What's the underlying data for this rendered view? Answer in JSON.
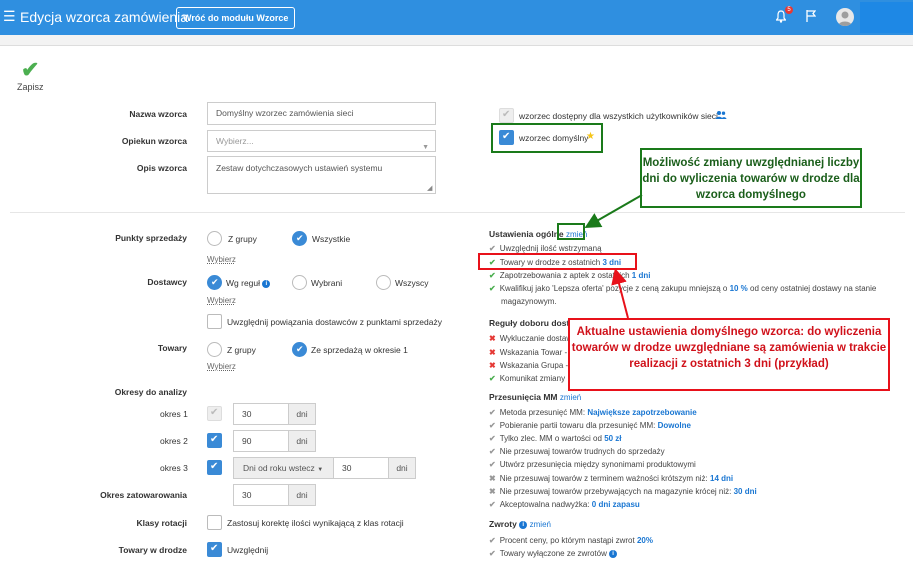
{
  "topbar": {
    "title": "Edycja wzorca zamówienia",
    "back_button": "Wróć do modułu Wzorce",
    "notification_count": "5",
    "colors": {
      "bar": "#2f8fe0"
    }
  },
  "toolbar": {
    "save_label": "Zapisz"
  },
  "form": {
    "name_label": "Nazwa wzorca",
    "name_value": "Domyślny wzorzec zamówienia sieci",
    "guardian_label": "Opiekun wzorca",
    "guardian_placeholder": "Wybierz...",
    "desc_label": "Opis wzorca",
    "desc_value": "Zestaw dotychczasowych ustawień systemu",
    "available_all": "wzorzec dostępny dla wszystkich użytkowników sieci",
    "default_template": "wzorzec domyślny"
  },
  "left": {
    "points_label": "Punkty sprzedaży",
    "points_opt1": "Z grupy",
    "points_opt2": "Wszystkie",
    "choose": "Wybierz",
    "suppliers_label": "Dostawcy",
    "sup_opt1": "Wg reguł",
    "sup_opt2": "Wybrani",
    "sup_opt3": "Wszyscy",
    "sup_links": "Uwzględnij powiązania dostawców z punktami sprzedaży",
    "goods_label": "Towary",
    "goods_opt1": "Z grupy",
    "goods_opt2": "Ze sprzedażą w okresie 1",
    "periods_label": "Okresy do analizy",
    "period1_label": "okres 1",
    "period1_value": "30",
    "period2_label": "okres 2",
    "period2_value": "90",
    "period3_label": "okres 3",
    "period3_select": "Dni od roku wstecz",
    "period3_value": "30",
    "days_unit": "dni",
    "stock_label": "Okres zatowarowania",
    "stock_value": "30",
    "rotation_label": "Klasy rotacji",
    "rotation_text": "Zastosuj korektę ilości wynikającą z klas rotacji",
    "transit_label": "Towary w drodze",
    "transit_text": "Uwzględnij"
  },
  "right": {
    "general_head": "Ustawienia ogólne",
    "change": "zmień",
    "g1": "Uwzględnij ilość wstrzymaną",
    "g2_prefix": "Towary w drodze z ostatnich",
    "g2_value": "3 dni",
    "g3_prefix": "Zapotrzebowania z aptek z ostatnich",
    "g3_value": "1 dni",
    "g4_prefix": "Kwalifikuj jako 'Lepsza oferta' pozycje z ceną zakupu mniejszą o",
    "g4_value": "10 %",
    "g4_suffix": "od ceny ostatniej dostawy na stanie",
    "g4_line2": "magazynowym.",
    "rules_head": "Reguły doboru dostaw",
    "r1": "Wykluczanie dostaw",
    "r2": "Wskazania Towar -",
    "r3": "Wskazania Grupa -",
    "r4": "Komunikat zmiany",
    "mm_head": "Przesunięcia MM",
    "m1_prefix": "Metoda przesunięć MM:",
    "m1_value": "Największe zapotrzebowanie",
    "m2_prefix": "Pobieranie partii towaru dla przesunięć MM:",
    "m2_value": "Dowolne",
    "m3_prefix": "Tylko zlec. MM o wartości od",
    "m3_value": "50 zł",
    "m4": "Nie przesuwaj towarów trudnych do sprzedaży",
    "m5": "Utwórz przesunięcia między synonimami produktowymi",
    "m6_prefix": "Nie przesuwaj towarów z terminem ważności krótszym niż:",
    "m6_value": "14 dni",
    "m7_prefix": "Nie przesuwaj towarów przebywających na magazynie krócej niż:",
    "m7_value": "30 dni",
    "m8_prefix": "Akceptowalna nadwyżka:",
    "m8_value": "0 dni zapasu",
    "returns_head": "Zwroty",
    "z1_prefix": "Procent ceny, po którym nastąpi zwrot",
    "z1_value": "20%",
    "z2": "Towary wyłączone ze zwrotów"
  },
  "annotations": {
    "green_callout": "Możliwość zmiany uwzględnianej liczby dni do wyliczenia towarów w drodze dla wzorca domyślnego",
    "red_callout": "Aktualne ustawienia domyślnego wzorca: do wyliczenia towarów w drodze uwzględniane są zamówienia w trakcie realizacji z ostatnich 3 dni (przykład)",
    "green_color": "#1a7a1a",
    "red_color": "#e8111a"
  }
}
